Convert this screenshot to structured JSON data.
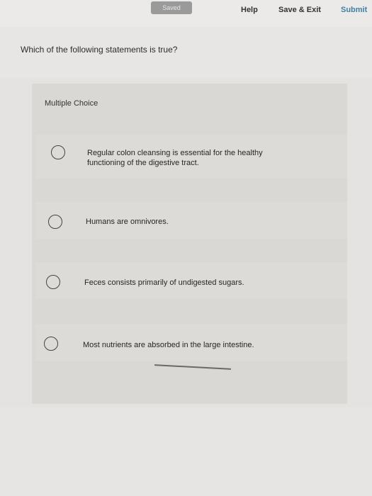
{
  "header": {
    "saved_label": "Saved",
    "help_label": "Help",
    "save_exit_label": "Save & Exit",
    "submit_label": "Submit"
  },
  "question": {
    "text": "Which of the following statements is true?"
  },
  "card": {
    "header": "Multiple Choice",
    "options": [
      {
        "label": "Regular colon cleansing is essential for the healthy functioning of the digestive tract."
      },
      {
        "label": "Humans are omnivores."
      },
      {
        "label": "Feces consists primarily of undigested sugars."
      },
      {
        "label": "Most nutrients are absorbed in the large intestine."
      }
    ]
  }
}
